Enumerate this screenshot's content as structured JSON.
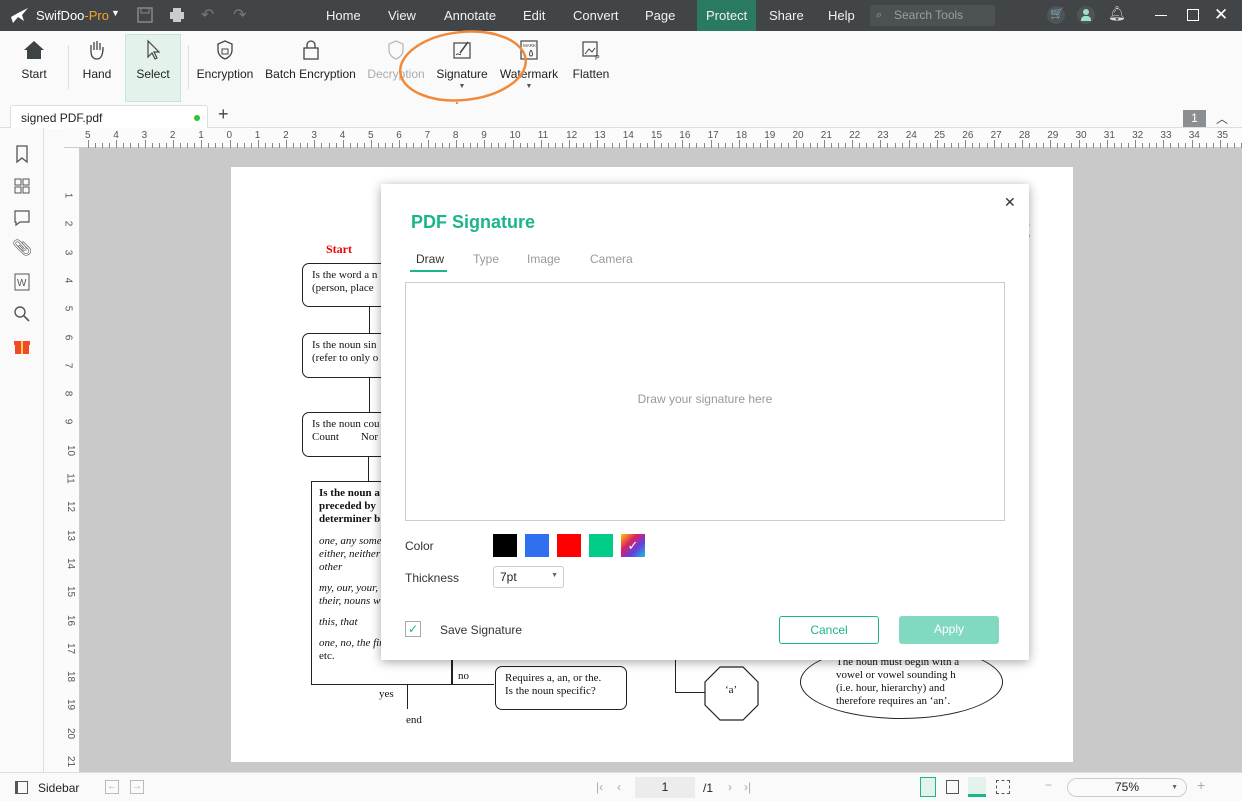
{
  "app": {
    "name": "SwifDoo",
    "edition": "-Pro"
  },
  "menu": [
    "Home",
    "View",
    "Annotate",
    "Edit",
    "Convert",
    "Page",
    "Protect",
    "Share",
    "Help"
  ],
  "active_menu": "Protect",
  "search": {
    "placeholder": "Search Tools"
  },
  "toolbar": {
    "start": "Start",
    "hand": "Hand",
    "select": "Select",
    "encryption": "Encryption",
    "batch_encryption": "Batch Encryption",
    "decryption": "Decryption",
    "signature": "Signature",
    "watermark": "Watermark",
    "flatten": "Flatten"
  },
  "tab": {
    "name": "signed PDF.pdf",
    "add": "+",
    "page_badge": "1"
  },
  "ruler": {
    "h": [
      "5",
      "4",
      "3",
      "2",
      "1",
      "0",
      "1",
      "2",
      "3",
      "4",
      "5",
      "6",
      "7",
      "8",
      "9",
      "10",
      "11",
      "12",
      "13",
      "14",
      "15",
      "16",
      "17",
      "18",
      "19",
      "20",
      "21",
      "22",
      "23",
      "24",
      "25",
      "26",
      "27",
      "28",
      "29",
      "30",
      "31",
      "32",
      "33",
      "34",
      "35"
    ],
    "v": [
      "1",
      "2",
      "3",
      "4",
      "5",
      "6",
      "7",
      "8",
      "9",
      "10",
      "11",
      "12",
      "13",
      "14",
      "15",
      "16",
      "17",
      "18",
      "19",
      "20",
      "21"
    ]
  },
  "flowchart": {
    "start": "Start",
    "b1": [
      "Is the word a n",
      "(person, place"
    ],
    "b2": [
      "Is the noun sin",
      "(refer to only o"
    ],
    "b3": [
      "Is the noun cou",
      "Count        Nor"
    ],
    "b4_bold": [
      "Is the noun a",
      "preceded by",
      "determiner b"
    ],
    "b4_list": [
      "one, any some,",
      "either, neither",
      "other",
      "my, our, your,",
      "their, nouns w",
      "this, that",
      "one, no, the fir",
      "etc."
    ],
    "yes": "yes",
    "no": "no",
    "end": "end",
    "requires": [
      "Requires a, an, or the.",
      "Is the noun specific?"
    ],
    "a_node": "‘a’",
    "ellipse": [
      "The noun must begin with a",
      "vowel or vowel sounding h",
      "(i.e. hour, hierarchy) and",
      "therefore requires an ‘an’."
    ]
  },
  "dialog": {
    "title": "PDF Signature",
    "tabs": [
      "Draw",
      "Type",
      "Image",
      "Camera"
    ],
    "active_tab": "Draw",
    "placeholder": "Draw your signature here",
    "color_label": "Color",
    "colors": [
      "#000000",
      "#2f6ff0",
      "#ff0000",
      "#00cc88",
      "gradient"
    ],
    "thickness_label": "Thickness",
    "thickness": "7pt",
    "save_signature": "Save Signature",
    "save_checked": true,
    "cancel": "Cancel",
    "apply": "Apply",
    "accent": "#1ab58a"
  },
  "status": {
    "sidebar": "Sidebar",
    "page": "1",
    "total": "/1",
    "zoom": "75%"
  }
}
